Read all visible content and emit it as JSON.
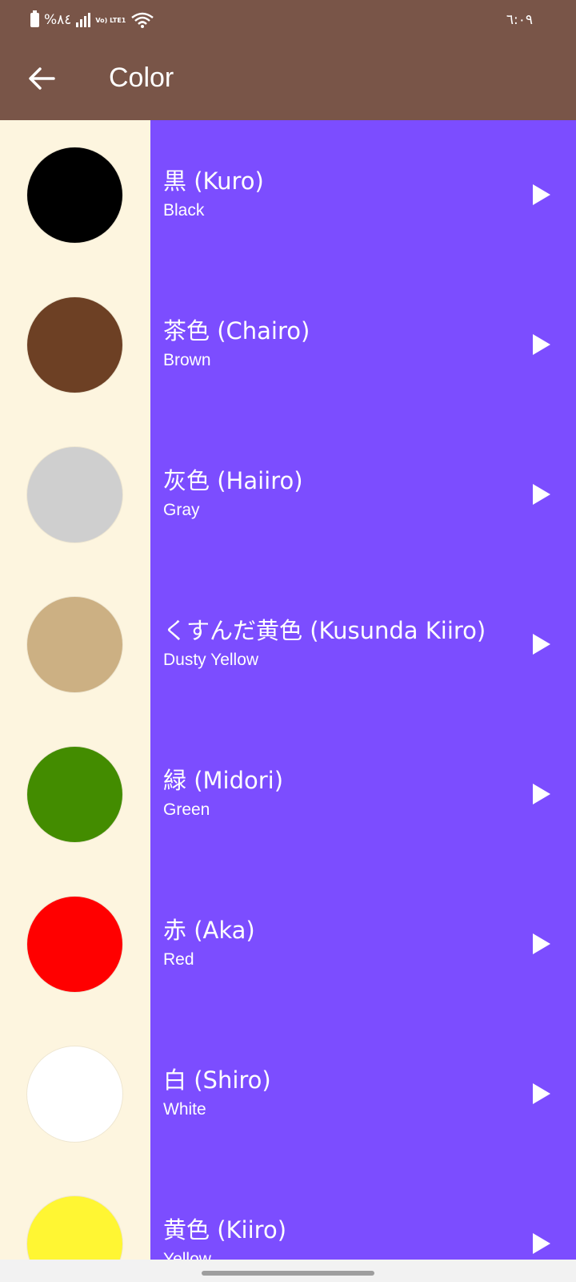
{
  "status_bar": {
    "battery_percent": "%٨٤",
    "lte_label": "Vo) LTE1",
    "time": "٦:٠٩"
  },
  "app_bar": {
    "title": "Color",
    "back_icon": "arrow-left-icon"
  },
  "colors": {
    "header_bg": "#795548",
    "list_bg": "#7C4DFF",
    "swatch_column_bg": "#FDF5DF"
  },
  "items": [
    {
      "jp": "黒 (Kuro)",
      "en": "Black",
      "swatch": "#000000"
    },
    {
      "jp": "茶色 (Chairo)",
      "en": "Brown",
      "swatch": "#6D4024"
    },
    {
      "jp": "灰色 (Haiiro)",
      "en": "Gray",
      "swatch": "#CFCFCF"
    },
    {
      "jp": "くすんだ黄色 (Kusunda Kiiro)",
      "en": "Dusty Yellow",
      "swatch": "#CCB083"
    },
    {
      "jp": "緑 (Midori)",
      "en": "Green",
      "swatch": "#438C00"
    },
    {
      "jp": "赤 (Aka)",
      "en": "Red",
      "swatch": "#FF0000"
    },
    {
      "jp": "白 (Shiro)",
      "en": "White",
      "swatch": "#FFFFFF"
    },
    {
      "jp": "黄色 (Kiiro)",
      "en": "Yellow",
      "swatch": "#FFF633"
    }
  ]
}
